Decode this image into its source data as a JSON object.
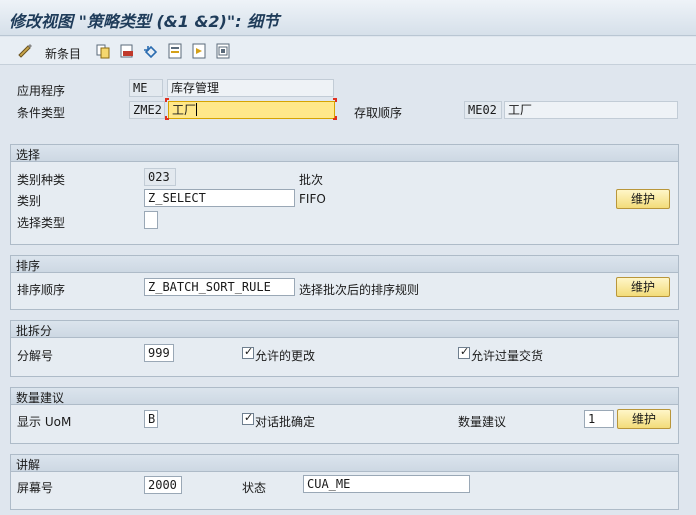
{
  "title": "修改视图 \"策略类型 (&1 &2)\": 细节",
  "toolbar": {
    "new_entries_label": "新条目"
  },
  "header": {
    "application_label": "应用程序",
    "application_code": "ME",
    "application_desc": "库存管理",
    "condition_type_label": "条件类型",
    "condition_type_code": "ZME2",
    "condition_type_desc": "工厂",
    "access_sequence_label": "存取顺序",
    "access_sequence_code": "ME02",
    "access_sequence_desc": "工厂"
  },
  "selection": {
    "header": "选择",
    "class_type_label": "类别种类",
    "class_type_value": "023",
    "class_type_desc": "批次",
    "class_label": "类别",
    "class_value": "Z_SELECT",
    "class_desc": "FIFO",
    "selection_type_label": "选择类型",
    "selection_type_value": "",
    "maintain_label": "维护"
  },
  "sort": {
    "header": "排序",
    "sort_sequence_label": "排序顺序",
    "sort_sequence_value": "Z_BATCH_SORT_RULE",
    "sort_sequence_desc": "选择批次后的排序规则",
    "maintain_label": "维护"
  },
  "split": {
    "header": "批拆分",
    "split_number_label": "分解号",
    "split_number_value": "999",
    "allow_changes_label": "允许的更改",
    "allow_changes_checked": true,
    "allow_overdelivery_label": "允许过量交货",
    "allow_overdelivery_checked": true
  },
  "quantity": {
    "header": "数量建议",
    "display_uom_label": "显示  UoM",
    "display_uom_value": "B",
    "dialog_label": "对话批确定",
    "dialog_checked": true,
    "quantity_proposal_label": "数量建议",
    "quantity_proposal_value": "1",
    "maintain_label": "维护"
  },
  "explain": {
    "header": "讲解",
    "screen_number_label": "屏幕号",
    "screen_number_value": "2000",
    "status_label": "状态",
    "status_value": "CUA_ME"
  },
  "colors": {
    "focus_bg": "#ffe88a",
    "button_bg": "#f3dc7a",
    "title": "#1f3c5a"
  }
}
